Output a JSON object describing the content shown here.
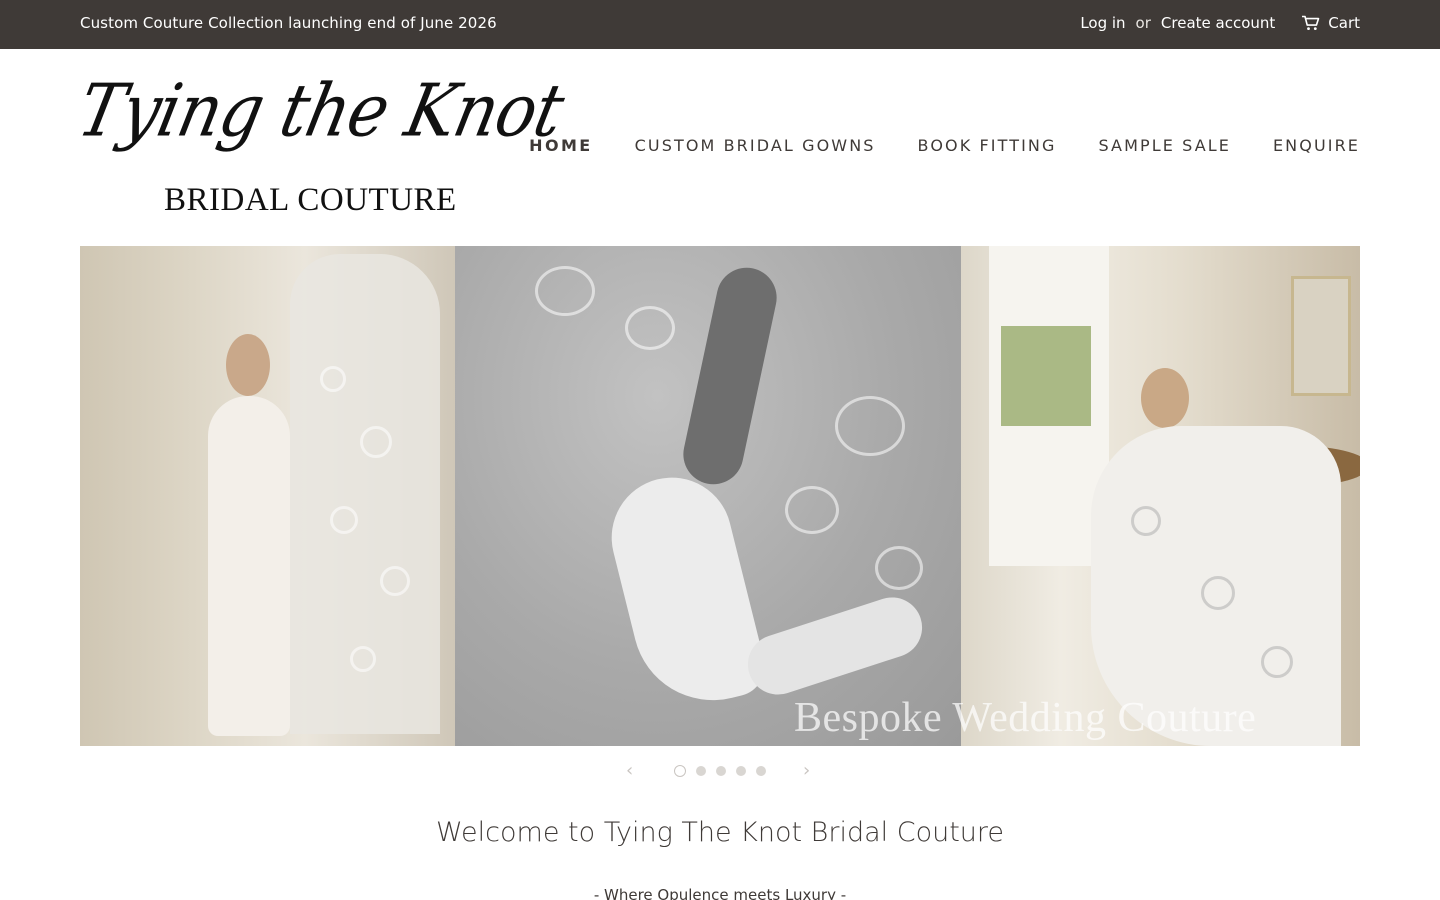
{
  "topbar": {
    "announcement": "Custom Couture Collection launching end of June 2026",
    "login": "Log in",
    "or": "or",
    "create_account": "Create account",
    "cart": "Cart",
    "cart_icon": "cart-icon"
  },
  "logo": {
    "script": "Tying the Knot",
    "subtitle": "BRIDAL COUTURE"
  },
  "nav": {
    "items": [
      {
        "label": "HOME",
        "active": true
      },
      {
        "label": "CUSTOM BRIDAL GOWNS",
        "active": false
      },
      {
        "label": "BOOK FITTING",
        "active": false
      },
      {
        "label": "SAMPLE SALE",
        "active": false
      },
      {
        "label": "ENQUIRE",
        "active": false
      }
    ]
  },
  "hero": {
    "caption": "Bespoke Wedding Couture",
    "slides_count": 5,
    "active_slide": 1,
    "prev_icon": "chevron-left-icon",
    "next_icon": "chevron-right-icon"
  },
  "welcome": {
    "heading": "Welcome to Tying The Knot Bridal Couture",
    "tagline": "- Where Opulence meets Luxury -"
  },
  "colors": {
    "topbar_bg": "#3f3a37",
    "text": "#3f3a37"
  }
}
